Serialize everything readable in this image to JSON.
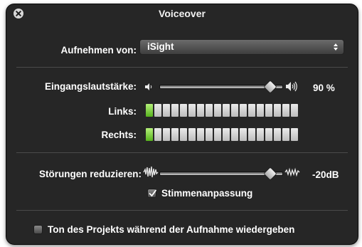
{
  "window": {
    "title": "Voiceover"
  },
  "record_from": {
    "label": "Aufnehmen von:",
    "value": "iSight"
  },
  "input_level": {
    "label": "Eingangslautstärke:",
    "value_text": "90 %",
    "slider_fraction": 0.9,
    "left_label": "Links:",
    "right_label": "Rechts:",
    "meter_segments": 18,
    "left_active": 1,
    "right_active": 1
  },
  "noise": {
    "label": "Störungen reduzieren:",
    "value_text": "-20dB",
    "slider_fraction": 0.9,
    "voice_enhance_label": "Stimmenanpassung",
    "voice_enhance_checked": true
  },
  "play_project": {
    "label": "Ton des Projekts während der Aufnahme wiedergeben",
    "checked": false
  },
  "icons": [
    "close-icon",
    "popup-arrows-icon",
    "speaker-low-icon",
    "speaker-high-icon",
    "noise-low-icon",
    "noise-high-icon",
    "checkmark-icon"
  ],
  "colors": {
    "panel": "#161616",
    "meter_active": "#6cc52a",
    "meter_idle": "#d9d9d9"
  }
}
